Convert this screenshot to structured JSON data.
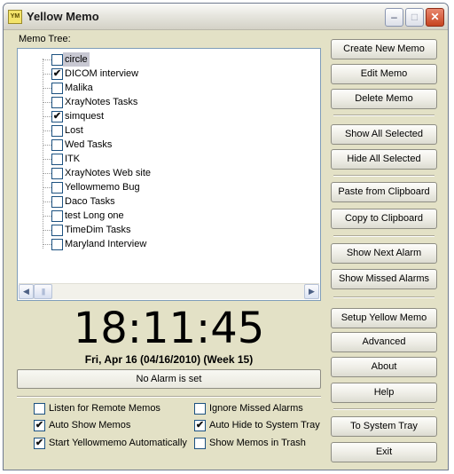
{
  "window": {
    "title": "Yellow Memo",
    "icon_text": "YM"
  },
  "titlebar_buttons": {
    "minimize": "–",
    "maximize": "□",
    "close": "✕"
  },
  "memo_tree": {
    "label": "Memo Tree:",
    "items": [
      {
        "label": "circle",
        "checked": false,
        "selected": true
      },
      {
        "label": "DICOM interview",
        "checked": true,
        "selected": false
      },
      {
        "label": "Malika",
        "checked": false,
        "selected": false
      },
      {
        "label": "XrayNotes Tasks",
        "checked": false,
        "selected": false
      },
      {
        "label": "simquest",
        "checked": true,
        "selected": false
      },
      {
        "label": "Lost",
        "checked": false,
        "selected": false
      },
      {
        "label": "Wed Tasks",
        "checked": false,
        "selected": false
      },
      {
        "label": "ITK",
        "checked": false,
        "selected": false
      },
      {
        "label": "XrayNotes Web site",
        "checked": false,
        "selected": false
      },
      {
        "label": "Yellowmemo Bug",
        "checked": false,
        "selected": false
      },
      {
        "label": "Daco Tasks",
        "checked": false,
        "selected": false
      },
      {
        "label": "test Long one",
        "checked": false,
        "selected": false
      },
      {
        "label": "TimeDim Tasks",
        "checked": false,
        "selected": false
      },
      {
        "label": "Maryland Interview",
        "checked": false,
        "selected": false
      }
    ],
    "scroll_left": "◀",
    "scroll_right": "▶",
    "scroll_thumb_grip": "|||"
  },
  "clock": {
    "time": "18:11:45",
    "date": "Fri, Apr 16 (04/16/2010) (Week 15)"
  },
  "alarm": {
    "status": "No Alarm is set"
  },
  "options": {
    "listen_remote": {
      "label": "Listen for Remote Memos",
      "checked": false
    },
    "auto_show": {
      "label": "Auto Show Memos",
      "checked": true
    },
    "start_auto": {
      "label": "Start Yellowmemo Automatically",
      "checked": true
    },
    "ignore_missed": {
      "label": "Ignore Missed Alarms",
      "checked": false
    },
    "auto_hide": {
      "label": "Auto Hide to System Tray",
      "checked": true
    },
    "show_trash": {
      "label": "Show Memos in Trash",
      "checked": false
    }
  },
  "buttons": {
    "create_new_memo": "Create New Memo",
    "edit_memo": "Edit Memo",
    "delete_memo": "Delete Memo",
    "show_all_selected": "Show All Selected",
    "hide_all_selected": "Hide All Selected",
    "paste_from_clipboard": "Paste from Clipboard",
    "copy_to_clipboard": "Copy to Clipboard",
    "show_next_alarm": "Show Next Alarm",
    "show_missed_alarms": "Show Missed Alarms",
    "setup_yellow_memo": "Setup Yellow Memo",
    "advanced": "Advanced",
    "about": "About",
    "help": "Help",
    "to_system_tray": "To System Tray",
    "exit": "Exit"
  },
  "check_mark": "✔"
}
